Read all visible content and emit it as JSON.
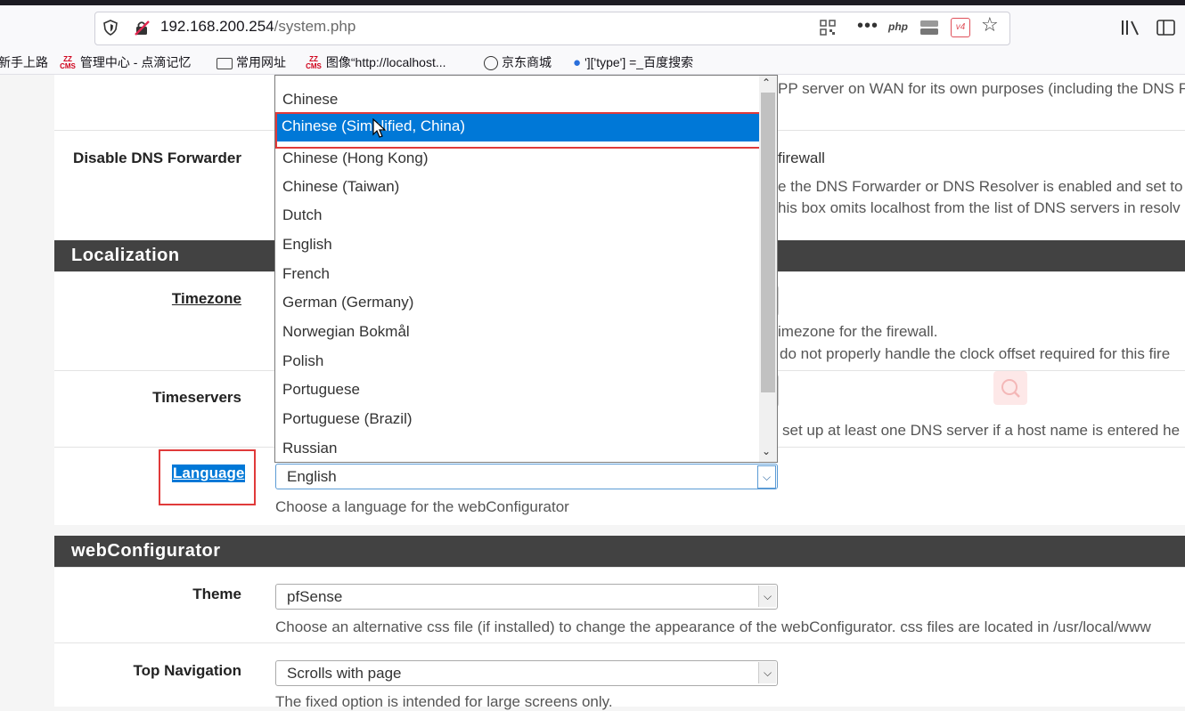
{
  "browser": {
    "url_host": "192.168.200.254",
    "url_path": "/system.php",
    "php_badge": "php",
    "v4_badge": "v4",
    "bookmarks": [
      "新手上路",
      "管理中心 - 点滴记忆",
      "常用网址",
      "图像“http://localhost...",
      "京东商城",
      "']['type'] =_百度搜索"
    ],
    "zz_cms": "ZZ CMS"
  },
  "sections": {
    "localization_title": "Localization",
    "webconfigurator_title": "webConfigurator"
  },
  "fields": {
    "top_partial_help": "PP server on WAN for its own purposes (including the DNS F",
    "disable_dns_label": "Disable DNS Forwarder",
    "disable_dns_right1": "firewall",
    "disable_dns_help1": "e the DNS Forwarder or DNS Resolver is enabled and set to l",
    "disable_dns_help2": "his box omits localhost from the list of DNS servers in resolv",
    "timezone_label": "Timezone",
    "timezone_help1": "imezone for the firewall.",
    "timezone_help2": "do not properly handle the clock offset required for this fire",
    "timeservers_label": "Timeservers",
    "timeservers_help": "set up at least one DNS server if a host name is entered he",
    "language_label": "Language",
    "language_value": "English",
    "language_help": "Choose a language for the webConfigurator",
    "theme_label": "Theme",
    "theme_value": "pfSense",
    "theme_help": "Choose an alternative css file (if installed) to change the appearance of the webConfigurator. css files are located in /usr/local/www",
    "topnav_label": "Top Navigation",
    "topnav_value": "Scrolls with page",
    "topnav_help": "The fixed option is intended for large screens only."
  },
  "language_dropdown": {
    "selected": "Chinese (Simplified, China)",
    "options": [
      "Chinese",
      "Chinese (Simplified, China)",
      "Chinese (Hong Kong)",
      "Chinese (Taiwan)",
      "Dutch",
      "English",
      "French",
      "German (Germany)",
      "Norwegian Bokmål",
      "Polish",
      "Portuguese",
      "Portuguese (Brazil)",
      "Russian"
    ]
  },
  "colors": {
    "section_header": "#424242",
    "selection_highlight": "#0078d7",
    "annotation_red": "#e03a3a"
  }
}
